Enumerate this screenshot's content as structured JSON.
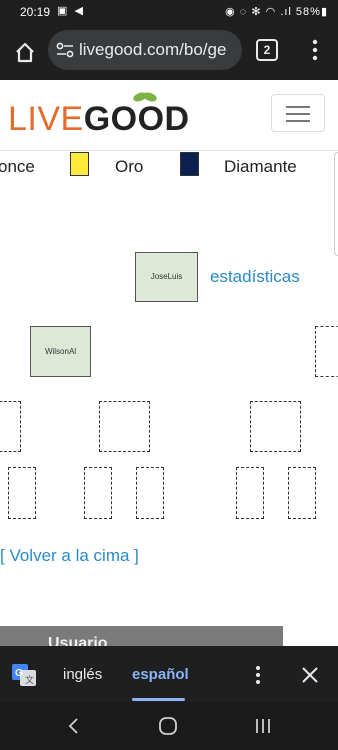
{
  "status_bar": {
    "time": "20:19",
    "notif_icons": "▣ ◀",
    "right_text": "◉ ◌ ✻ ◠ .ıl 58%▮"
  },
  "browser": {
    "url": "livegood.com/bo/ge",
    "tab_count": "2"
  },
  "site": {
    "logo_live": "LIVE",
    "logo_good": "GOOD"
  },
  "legend": [
    {
      "label": "once",
      "color": "#ffffff"
    },
    {
      "label": "Oro",
      "color": "#ffeb3b"
    },
    {
      "label": "Diamante",
      "color": "#0d2151"
    }
  ],
  "tree": {
    "nodes": [
      {
        "name": "JoseLuis"
      },
      {
        "name": "WilsonAl"
      }
    ],
    "stats_link": "estadísticas",
    "back_to_top": "[ Volver a la cima ]"
  },
  "table_header": "Usuario",
  "translate_bar": {
    "source_lang": "inglés",
    "target_lang": "español"
  },
  "colors": {
    "accent_blue": "#2a8ac8",
    "brand_orange": "#e36b2c",
    "node_fill": "#dde8d6"
  }
}
